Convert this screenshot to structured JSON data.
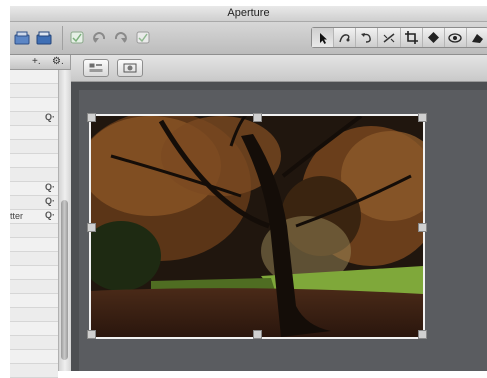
{
  "window": {
    "title": "Aperture"
  },
  "toolbar": {
    "left_icons": [
      "import-icon",
      "export-icon",
      "checkbox-icon",
      "rotate-left-icon",
      "rotate-right-icon",
      "check-icon"
    ],
    "tools": [
      "pointer-icon",
      "lift-stamp-icon",
      "rotate-icon",
      "straighten-icon",
      "crop-icon",
      "stamp-icon",
      "redeye-icon",
      "retouch-icon"
    ],
    "selected_tool": "pointer-icon"
  },
  "subbar": {
    "icons": [
      "viewer-mode-icon",
      "filmstrip-icon"
    ]
  },
  "left_panel": {
    "header_add": "+.",
    "header_gear": "⚙.",
    "row_labels": [
      "",
      "",
      "",
      "",
      "",
      "",
      "",
      "tter",
      "",
      "",
      "",
      "",
      "",
      "",
      "",
      "",
      "",
      "",
      "",
      "",
      "",
      "",
      ""
    ],
    "search_rows": [
      3,
      8,
      9,
      10
    ]
  },
  "colors": {
    "viewer_bg": "#5a5c60",
    "toolbar_bg": "#c9c9c9"
  }
}
